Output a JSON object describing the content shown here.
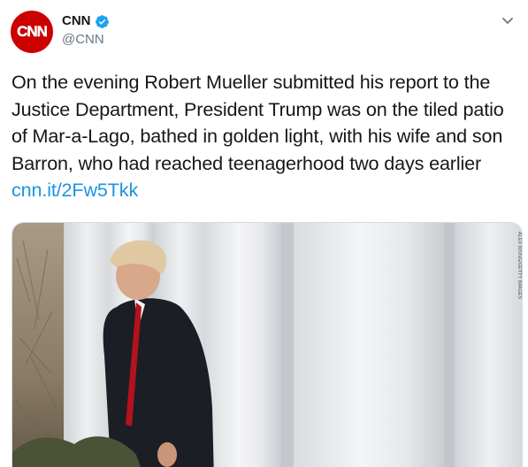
{
  "account": {
    "avatar_text": "CNN",
    "display_name": "CNN",
    "handle": "@CNN",
    "verified": true
  },
  "menu": {
    "icon": "chevron-down-icon"
  },
  "tweet": {
    "text": "On the evening Robert Mueller submitted his report to the Justice Department, President Trump was on the tiled patio of Mar-a-Lago, bathed in golden light, with his wife and son Barron, who had reached teenagerhood two days earlier",
    "link": "cnn.it/2Fw5Tkk"
  },
  "media": {
    "photo_credit": "ALEX WONG/GETTY IMAGES"
  },
  "colors": {
    "brand": "#cc0000",
    "link": "#1b95e0",
    "verified": "#1da1f2",
    "handle": "#657786"
  }
}
